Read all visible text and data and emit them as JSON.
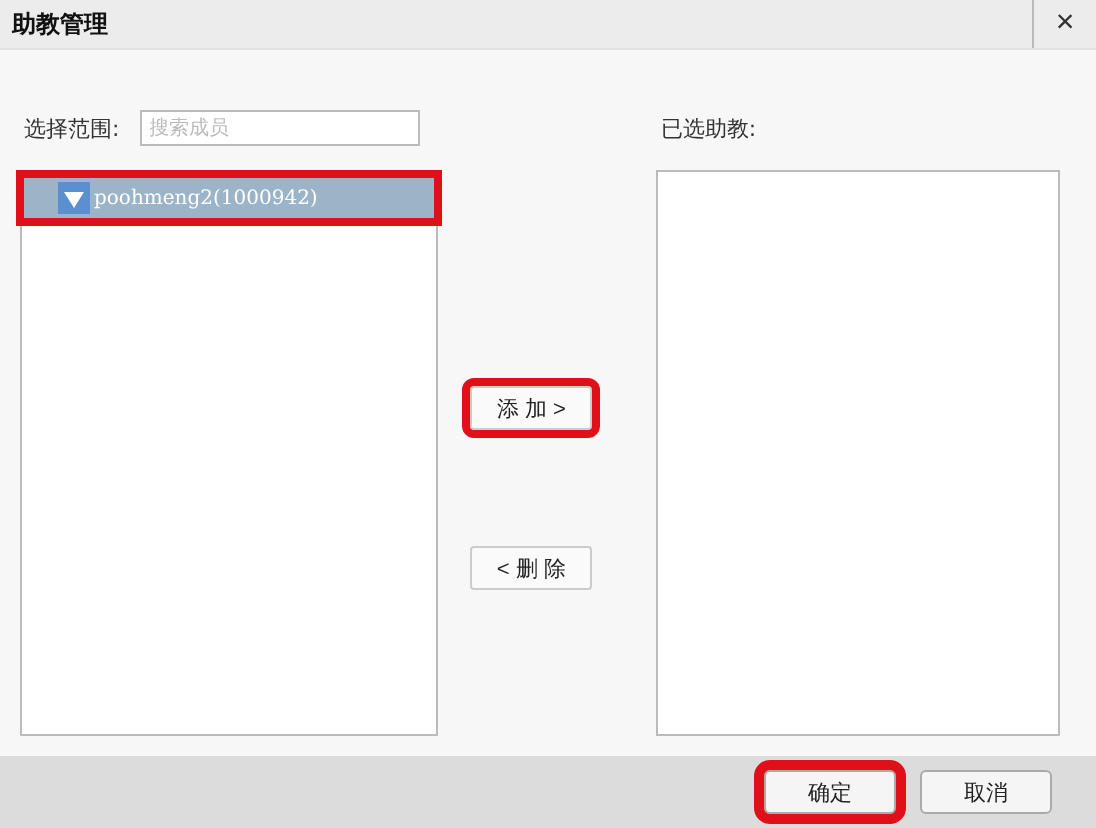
{
  "window": {
    "title": "助教管理",
    "close": "×"
  },
  "scope": {
    "label": "选择范围:",
    "search": {
      "placeholder": "搜索成员"
    },
    "members": [
      {
        "name": "poohmeng2(1000942)",
        "selected": true,
        "highlighted": true
      }
    ]
  },
  "chosen": {
    "label": "已选助教:"
  },
  "actions": [
    {
      "label": "添 加 >",
      "highlighted": true
    },
    {
      "label": "< 删 除",
      "highlighted": false
    }
  ],
  "buttons": [
    {
      "label": "确定",
      "highlighted": true
    },
    {
      "label": "取消",
      "highlighted": false
    }
  ]
}
